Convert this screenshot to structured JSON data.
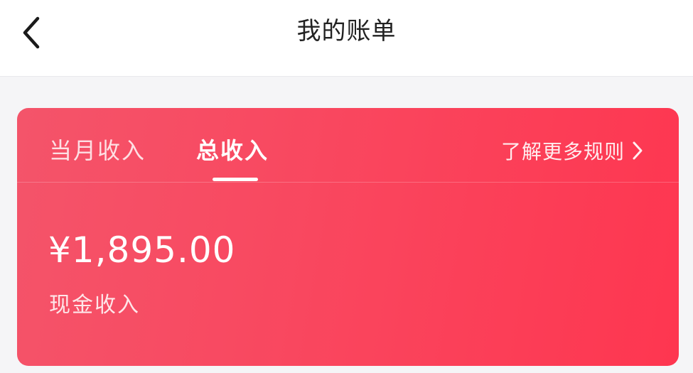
{
  "header": {
    "title": "我的账单",
    "back_icon": "chevron-left-icon"
  },
  "income_card": {
    "tabs": [
      {
        "label": "当月收入",
        "selected": false
      },
      {
        "label": "总收入",
        "selected": true
      }
    ],
    "rules_link": {
      "label": "了解更多规则",
      "icon": "chevron-right-icon"
    },
    "amount": "¥1,895.00",
    "amount_label": "现金收入",
    "colors": {
      "gradient_start": "#f4546a",
      "gradient_end": "#fe3650",
      "text": "#ffffff"
    }
  }
}
